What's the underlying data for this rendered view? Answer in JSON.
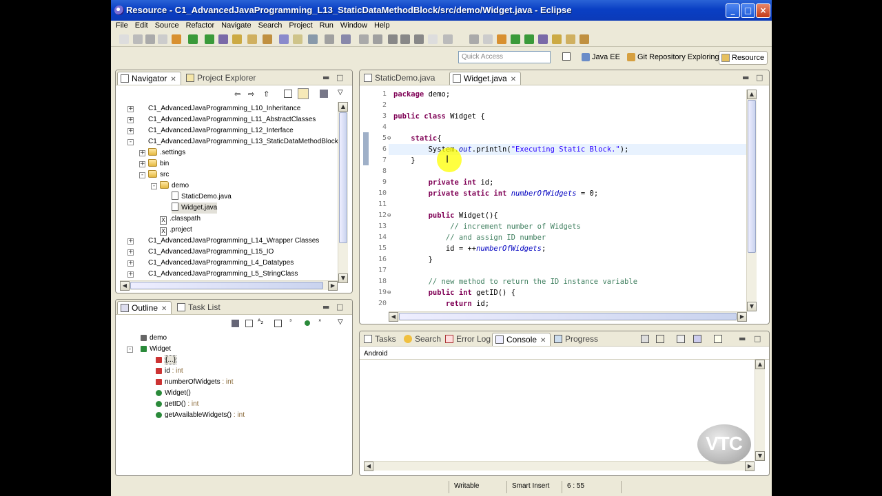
{
  "window": {
    "title": "Resource - C1_AdvancedJavaProgramming_L13_StaticDataMethodBlock/src/demo/Widget.java - Eclipse"
  },
  "menu": [
    "File",
    "Edit",
    "Source",
    "Refactor",
    "Navigate",
    "Search",
    "Project",
    "Run",
    "Window",
    "Help"
  ],
  "quick_access": {
    "placeholder": "Quick Access"
  },
  "perspectives": [
    "Java EE",
    "Git Repository Exploring",
    "Resource"
  ],
  "navigator": {
    "tabs": [
      "Navigator",
      "Project Explorer"
    ],
    "items": [
      {
        "label": "C1_AdvancedJavaProgramming_L10_Inheritance",
        "type": "project"
      },
      {
        "label": "C1_AdvancedJavaProgramming_L11_AbstractClasses",
        "type": "project"
      },
      {
        "label": "C1_AdvancedJavaProgramming_L12_Interface",
        "type": "project"
      },
      {
        "label": "C1_AdvancedJavaProgramming_L13_StaticDataMethodBlock",
        "type": "project"
      },
      {
        "label": ".settings",
        "type": "folder"
      },
      {
        "label": "bin",
        "type": "folder"
      },
      {
        "label": "src",
        "type": "folder"
      },
      {
        "label": "demo",
        "type": "folder"
      },
      {
        "label": "StaticDemo.java",
        "type": "file"
      },
      {
        "label": "Widget.java",
        "type": "file"
      },
      {
        "label": ".classpath",
        "type": "xfile"
      },
      {
        "label": ".project",
        "type": "xfile"
      },
      {
        "label": "C1_AdvancedJavaProgramming_L14_Wrapper Classes",
        "type": "project"
      },
      {
        "label": "C1_AdvancedJavaProgramming_L15_IO",
        "type": "project"
      },
      {
        "label": "C1_AdvancedJavaProgramming_L4_Datatypes",
        "type": "project"
      },
      {
        "label": "C1_AdvancedJavaProgramming_L5_StringClass",
        "type": "project"
      }
    ]
  },
  "outline": {
    "tabs": [
      "Outline",
      "Task List"
    ],
    "items": [
      {
        "label": "demo",
        "type": ""
      },
      {
        "label": "Widget",
        "type": ""
      },
      {
        "label": "{...}",
        "type": ""
      },
      {
        "label": "id",
        "type": ": int"
      },
      {
        "label": "numberOfWidgets",
        "type": ": int"
      },
      {
        "label": "Widget()",
        "type": ""
      },
      {
        "label": "getID()",
        "type": ": int"
      },
      {
        "label": "getAvailableWidgets()",
        "type": ": int"
      }
    ]
  },
  "editor": {
    "tabs": [
      "StaticDemo.java",
      "Widget.java"
    ],
    "lines": [
      {
        "n": "1",
        "html": "<span class='kw'>package</span> demo;"
      },
      {
        "n": "2",
        "html": ""
      },
      {
        "n": "3",
        "html": "<span class='kw'>public class</span> Widget {"
      },
      {
        "n": "4",
        "html": ""
      },
      {
        "n": "5",
        "html": "    <span class='kw'>static</span>{"
      },
      {
        "n": "6",
        "html": "        System.<span class='it'>out</span>.println(<span class='st'>\"Executing Static Block.\"</span>);"
      },
      {
        "n": "7",
        "html": "    }"
      },
      {
        "n": "8",
        "html": ""
      },
      {
        "n": "9",
        "html": "        <span class='kw'>private int</span> id;"
      },
      {
        "n": "10",
        "html": "        <span class='kw'>private static int</span> <span class='it'>numberOfWidgets</span> = 0;"
      },
      {
        "n": "11",
        "html": ""
      },
      {
        "n": "12",
        "html": "        <span class='kw'>public</span> Widget(){"
      },
      {
        "n": "13",
        "html": "             <span class='cm'>// increment number of Widgets</span>"
      },
      {
        "n": "14",
        "html": "            <span class='cm'>// and assign ID number</span>"
      },
      {
        "n": "15",
        "html": "            id = ++<span class='it'>numberOfWidgets</span>;"
      },
      {
        "n": "16",
        "html": "        }"
      },
      {
        "n": "17",
        "html": ""
      },
      {
        "n": "18",
        "html": "        <span class='cm'>// new method to return the ID instance variable</span>"
      },
      {
        "n": "19",
        "html": "        <span class='kw'>public int</span> getID() {"
      },
      {
        "n": "20",
        "html": "            <span class='kw'>return</span> id;"
      }
    ]
  },
  "console": {
    "tabs": [
      "Tasks",
      "Search",
      "Error Log",
      "Console",
      "Progress"
    ],
    "label": "Android"
  },
  "status": {
    "mode": "Writable",
    "insert": "Smart Insert",
    "position": "6 : 55"
  },
  "logo": "VTC"
}
